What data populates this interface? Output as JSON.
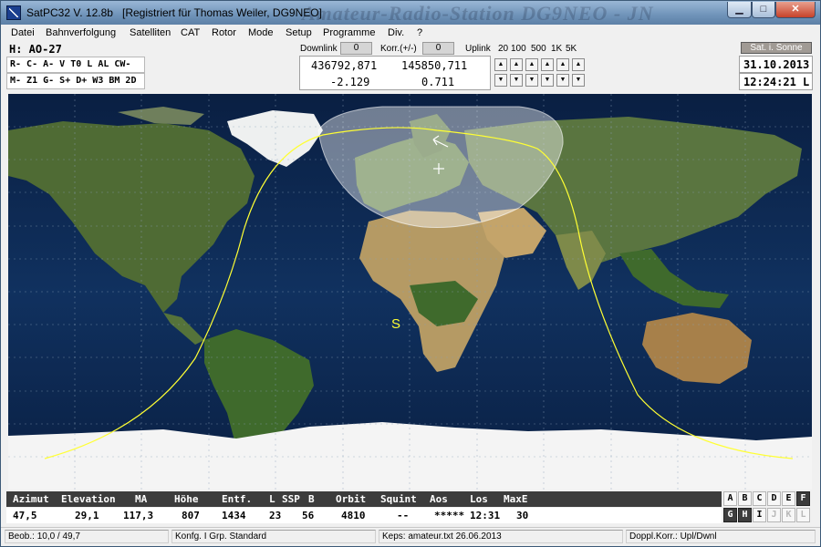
{
  "window": {
    "title": "SatPC32 V. 12.8b",
    "registration": "[Registriert für Thomas Weiler, DG9NEO]",
    "watermark": "Amateur-Radio-Station DG9NEO - JN"
  },
  "menu": [
    "Datei",
    "Bahnverfolgung",
    "Satelliten",
    "CAT",
    "Rotor",
    "Mode",
    "Setup",
    "Programme",
    "Div.",
    "?"
  ],
  "satellite": {
    "label": "H: AO-27"
  },
  "status_row1": "R- C- A-  V T0 L AL CW-",
  "status_row2": "M- Z1 G- S+ D+ W3 BM 2D",
  "frequency": {
    "downlink_label": "Downlink",
    "downlink_value": "0",
    "korr_label": "Korr.(+/-)",
    "korr_value": "0",
    "uplink_label": "Uplink",
    "steps": [
      "20",
      "100",
      "500",
      "1K",
      "5K"
    ],
    "downlink_freq": "436792,871",
    "uplink_freq": "145850,711",
    "downlink_doppler": "-2.129",
    "uplink_doppler": "0.711",
    "arrow_up": "▲",
    "arrow_down": "▼"
  },
  "sun": {
    "badge": "Sat. i. Sonne"
  },
  "datetime": {
    "date": "31.10.2013",
    "time": "12:24:21 L"
  },
  "map": {
    "sun_marker": "S"
  },
  "readout": {
    "headers": [
      "Azimut",
      "Elevation",
      "MA",
      "Höhe",
      "Entf.",
      "L",
      "SSP",
      "B",
      "Orbit",
      "Squint",
      "Aos",
      "Los",
      "MaxE"
    ],
    "values": [
      "47,5",
      "29,1",
      "117,3",
      "807",
      "1434",
      "23",
      "56",
      "4810",
      "--",
      "*****",
      "12:31",
      "30"
    ]
  },
  "sat_grid": [
    [
      "A",
      "B",
      "C",
      "D",
      "E",
      "F"
    ],
    [
      "G",
      "H",
      "I",
      "J",
      "K",
      "L"
    ]
  ],
  "statusbar": {
    "observer": "Beob.: 10,0 / 49,7",
    "config": "Konfg. I  Grp. Standard",
    "keps": "Keps: amateur.txt 26.06.2013",
    "doppler": "Doppl.Korr.: Upl/Dwnl"
  },
  "colors": {
    "ocean": "#0c2348",
    "land": "#4f6b34",
    "desert": "#b59a64",
    "ice": "#f4f4f4",
    "track": "#ffff33",
    "footprint": "rgba(255,255,255,0.42)",
    "readout_header_bg": "#3c3c3c"
  }
}
